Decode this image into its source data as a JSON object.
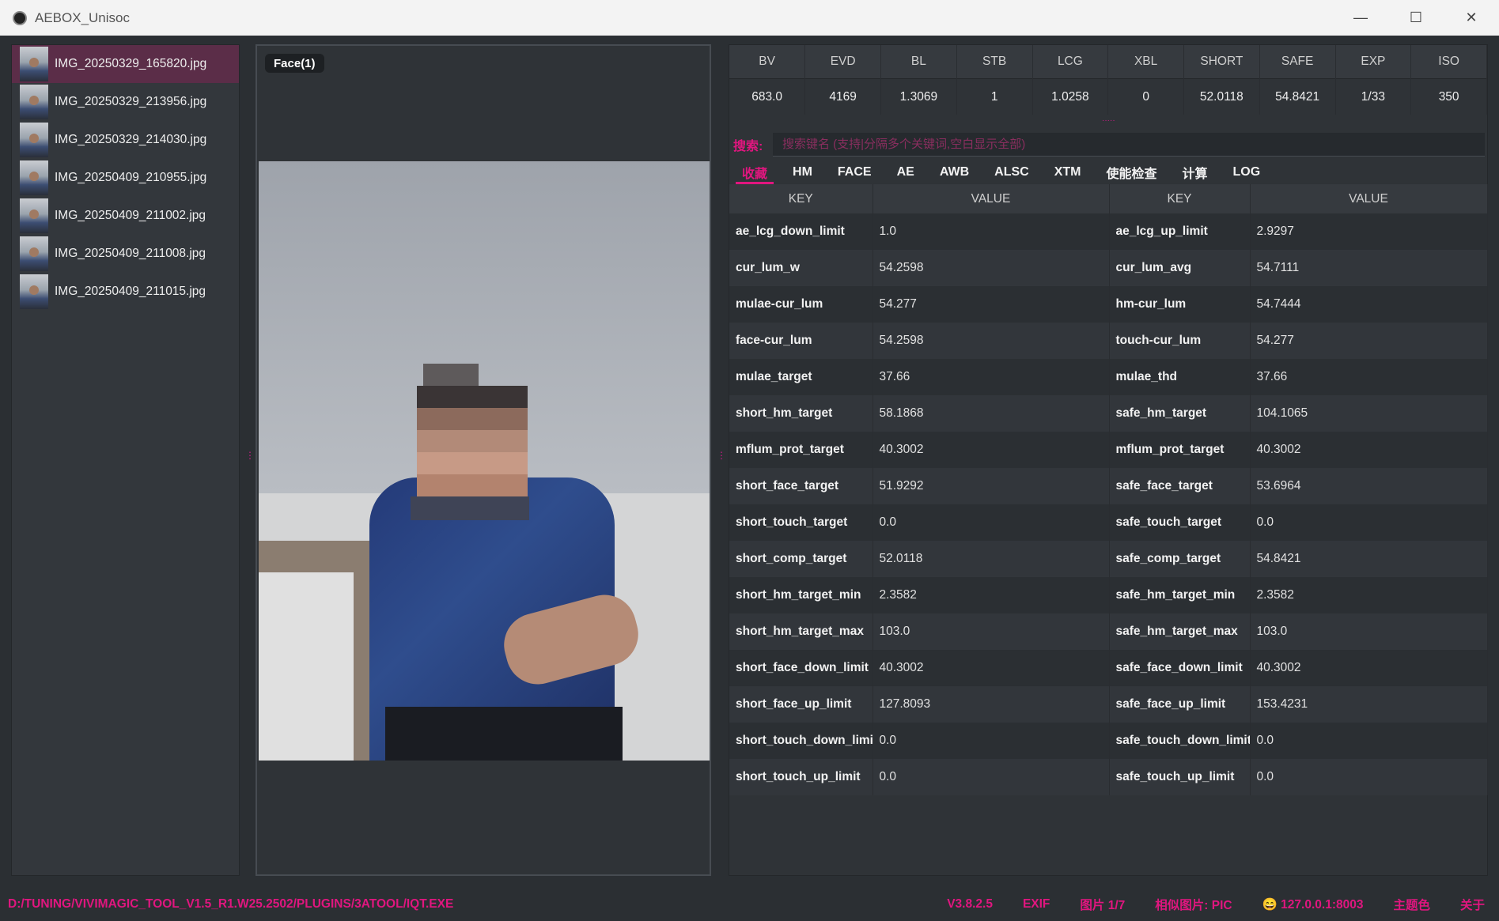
{
  "window": {
    "title": "AEBOX_Unisoc",
    "controls": {
      "minimize": "—",
      "maximize": "☐",
      "close": "✕"
    }
  },
  "files": [
    {
      "name": "IMG_20250329_165820.jpg",
      "selected": true
    },
    {
      "name": "IMG_20250329_213956.jpg",
      "selected": false
    },
    {
      "name": "IMG_20250329_214030.jpg",
      "selected": false
    },
    {
      "name": "IMG_20250409_210955.jpg",
      "selected": false
    },
    {
      "name": "IMG_20250409_211002.jpg",
      "selected": false
    },
    {
      "name": "IMG_20250409_211008.jpg",
      "selected": false
    },
    {
      "name": "IMG_20250409_211015.jpg",
      "selected": false
    }
  ],
  "preview": {
    "face_tag": "Face(1)"
  },
  "stats": {
    "headers": [
      "BV",
      "EVD",
      "BL",
      "STB",
      "LCG",
      "XBL",
      "SHORT",
      "SAFE",
      "EXP",
      "ISO"
    ],
    "values": [
      "683.0",
      "4169",
      "1.3069",
      "1",
      "1.0258",
      "0",
      "52.0118",
      "54.8421",
      "1/33",
      "350"
    ]
  },
  "search": {
    "label": "搜索:",
    "placeholder": "搜索键名 (支持|分隔多个关键词,空白显示全部)"
  },
  "tabs": [
    "收藏",
    "HM",
    "FACE",
    "AE",
    "AWB",
    "ALSC",
    "XTM",
    "使能检查",
    "计算",
    "LOG"
  ],
  "active_tab": "收藏",
  "kv_table": {
    "headers": [
      "KEY",
      "VALUE",
      "KEY",
      "VALUE"
    ],
    "rows": [
      [
        "ae_lcg_down_limit",
        "1.0",
        "ae_lcg_up_limit",
        "2.9297"
      ],
      [
        "cur_lum_w",
        "54.2598",
        "cur_lum_avg",
        "54.7111"
      ],
      [
        "mulae-cur_lum",
        "54.277",
        "hm-cur_lum",
        "54.7444"
      ],
      [
        "face-cur_lum",
        "54.2598",
        "touch-cur_lum",
        "54.277"
      ],
      [
        "mulae_target",
        "37.66",
        "mulae_thd",
        "37.66"
      ],
      [
        "short_hm_target",
        "58.1868",
        "safe_hm_target",
        "104.1065"
      ],
      [
        "mflum_prot_target",
        "40.3002",
        "mflum_prot_target",
        "40.3002"
      ],
      [
        "short_face_target",
        "51.9292",
        "safe_face_target",
        "53.6964"
      ],
      [
        "short_touch_target",
        "0.0",
        "safe_touch_target",
        "0.0"
      ],
      [
        "short_comp_target",
        "52.0118",
        "safe_comp_target",
        "54.8421"
      ],
      [
        "short_hm_target_min",
        "2.3582",
        "safe_hm_target_min",
        "2.3582"
      ],
      [
        "short_hm_target_max",
        "103.0",
        "safe_hm_target_max",
        "103.0"
      ],
      [
        "short_face_down_limit",
        "40.3002",
        "safe_face_down_limit",
        "40.3002"
      ],
      [
        "short_face_up_limit",
        "127.8093",
        "safe_face_up_limit",
        "153.4231"
      ],
      [
        "short_touch_down_limit",
        "0.0",
        "safe_touch_down_limit",
        "0.0"
      ],
      [
        "short_touch_up_limit",
        "0.0",
        "safe_touch_up_limit",
        "0.0"
      ]
    ]
  },
  "status": {
    "path": "D:/TUNING/VIVIMAGIC_TOOL_V1.5_R1.W25.2502/PLUGINS/3ATOOL/IQT.EXE",
    "version": "V3.8.2.5",
    "exif": "EXIF",
    "picture_count": "图片 1/7",
    "similar": "相似图片: PIC",
    "server": "😄 127.0.0.1:8003",
    "theme": "主题色",
    "about": "关于"
  },
  "colors": {
    "accent": "#e0167f",
    "selected_row": "#5b2d48",
    "background": "#2b2f33"
  }
}
